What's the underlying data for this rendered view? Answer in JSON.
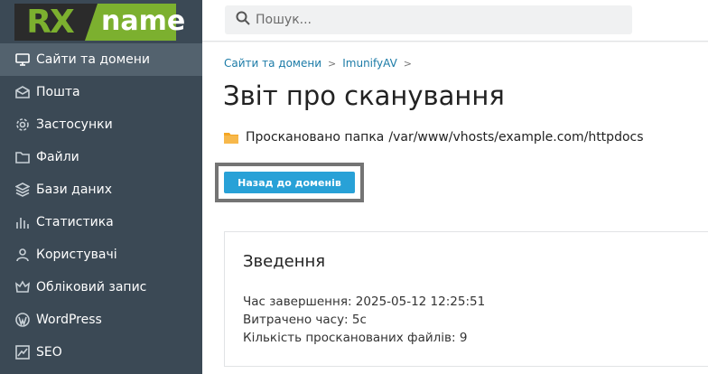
{
  "logo": {
    "left": "RX",
    "right": "name"
  },
  "search": {
    "placeholder": "Пошук..."
  },
  "sidebar": {
    "items": [
      {
        "label": "Сайти та домени",
        "icon": "monitor-icon",
        "active": true
      },
      {
        "label": "Пошта",
        "icon": "mail-icon"
      },
      {
        "label": "Застосунки",
        "icon": "gear-icon"
      },
      {
        "label": "Файли",
        "icon": "folder-icon"
      },
      {
        "label": "Бази даних",
        "icon": "database-icon"
      },
      {
        "label": "Статистика",
        "icon": "bar-chart-icon"
      },
      {
        "label": "Користувачі",
        "icon": "user-icon"
      },
      {
        "label": "Обліковий запис",
        "icon": "crown-icon"
      },
      {
        "label": "WordPress",
        "icon": "wordpress-icon"
      },
      {
        "label": "SEO",
        "icon": "seo-chart-icon"
      }
    ]
  },
  "breadcrumb": {
    "item1": "Сайти та домени",
    "item2": "ImunifyAV"
  },
  "page": {
    "title": "Звіт про сканування",
    "folder_label": "Проскановано папка",
    "folder_path": "/var/www/vhosts/example.com/httpdocs",
    "back_button": "Назад до доменів"
  },
  "summary": {
    "title": "Зведення",
    "finish_time": "Час завершення: 2025-05-12 12:25:51",
    "time_spent": "Витрачено часу: 5с",
    "files_scanned": "Кількість просканованих файлів: 9"
  },
  "colors": {
    "sidebar": "#3b4955",
    "sidebar_active": "#53626e",
    "accent": "#28a1d7",
    "logo_green": "#7cb02f",
    "link": "#1b7ba7"
  }
}
